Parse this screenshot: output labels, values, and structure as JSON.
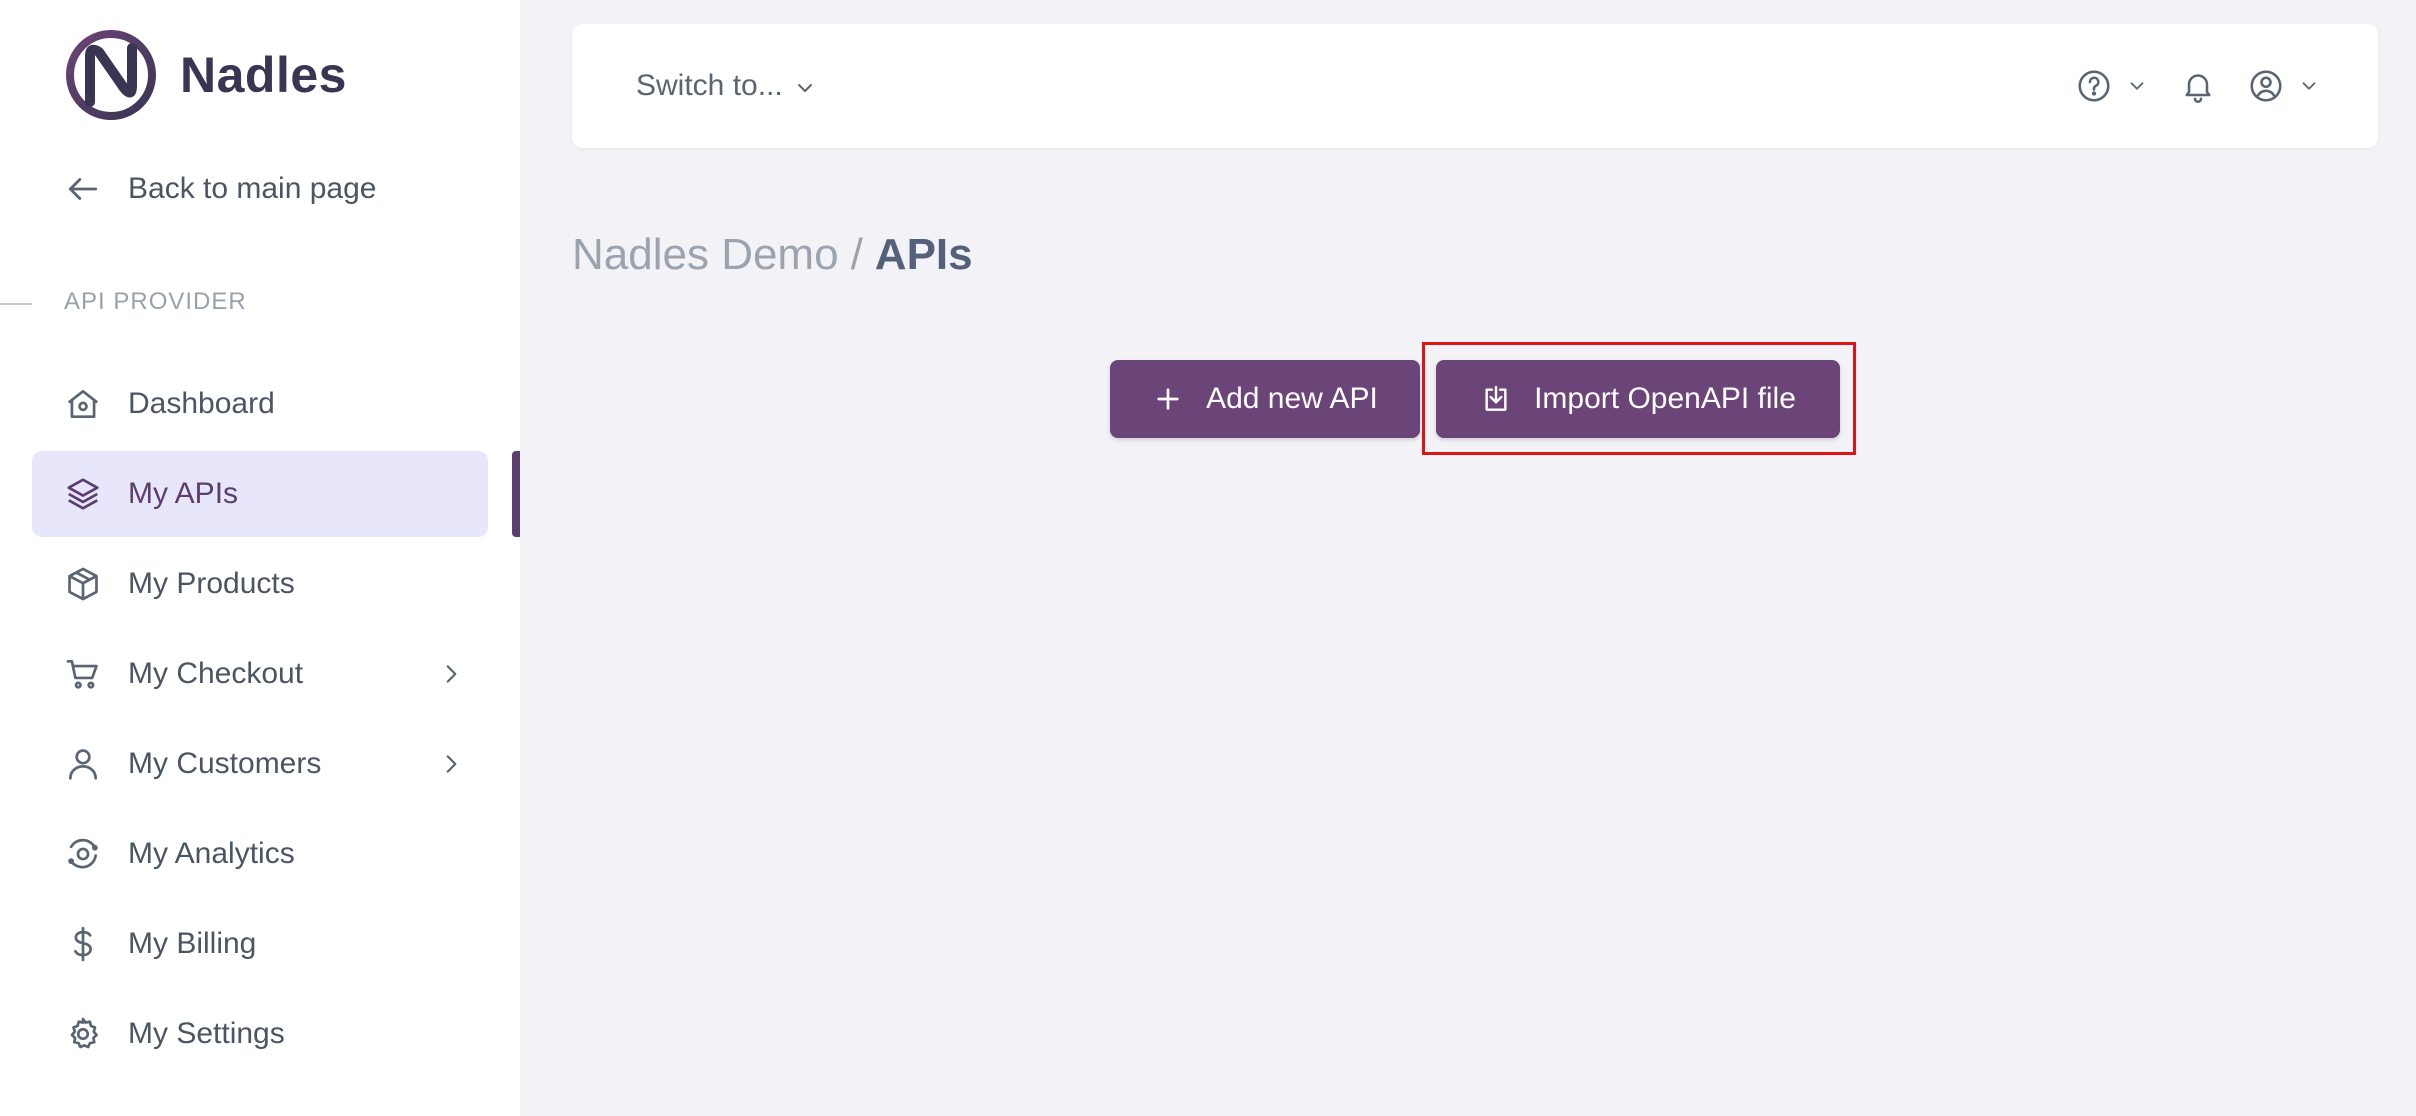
{
  "brand": {
    "name": "Nadles",
    "accent": "#5b3d6e",
    "button_color": "#6b4478"
  },
  "sidebar": {
    "back_label": "Back to main page",
    "section_title": "API PROVIDER",
    "items": [
      {
        "label": "Dashboard",
        "icon": "home-icon",
        "active": false
      },
      {
        "label": "My APIs",
        "icon": "layers-icon",
        "active": true
      },
      {
        "label": "My Products",
        "icon": "cube-icon",
        "active": false
      },
      {
        "label": "My Checkout",
        "icon": "cart-icon",
        "active": false,
        "has_submenu": true
      },
      {
        "label": "My Customers",
        "icon": "user-icon",
        "active": false,
        "has_submenu": true
      },
      {
        "label": "My Analytics",
        "icon": "analytics-icon",
        "active": false
      },
      {
        "label": "My Billing",
        "icon": "dollar-icon",
        "active": false
      },
      {
        "label": "My Settings",
        "icon": "gear-icon",
        "active": false
      }
    ]
  },
  "topbar": {
    "switch_label": "Switch to..."
  },
  "breadcrumb": {
    "parent": "Nadles Demo",
    "separator": "/",
    "current": "APIs"
  },
  "actions": {
    "add_label": "Add new API",
    "import_label": "Import OpenAPI file"
  }
}
